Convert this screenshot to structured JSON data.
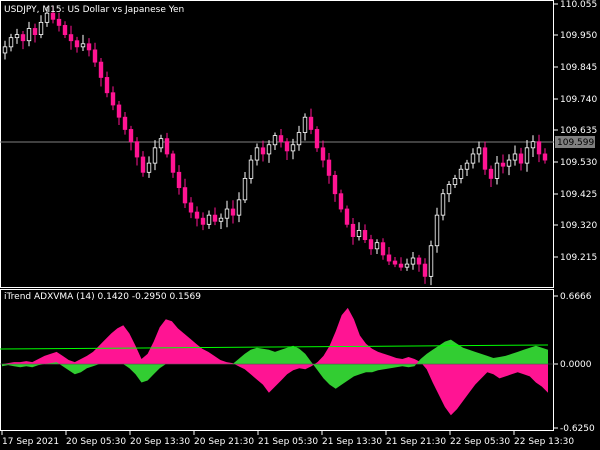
{
  "window": {
    "symbol_label": "USDJPY, M15:  US Dollar vs Japanese Yen"
  },
  "price_axis": {
    "ticks": [
      "110.055",
      "109.950",
      "109.845",
      "109.740",
      "109.635",
      "109.530",
      "109.425",
      "109.320",
      "109.215"
    ],
    "current_price": "109.599"
  },
  "indicator": {
    "label": "iTrend ADXVMA (14) 0.1420 -0.2950 0.1569",
    "ticks": [
      "0.6666",
      "0.0000",
      "-0.6250"
    ]
  },
  "time_axis": {
    "ticks": [
      "17 Sep 2021",
      "20 Sep 05:30",
      "20 Sep 13:30",
      "20 Sep 21:30",
      "21 Sep 05:30",
      "21 Sep 13:30",
      "21 Sep 21:30",
      "22 Sep 05:30",
      "22 Sep 13:30"
    ]
  },
  "colors": {
    "background": "#000000",
    "grid": "#ffffff",
    "bull_candle": "#ffffff",
    "bear_candle": "#ff1493",
    "price_line": "#808080",
    "indicator_pink": "#ff1493",
    "indicator_green": "#32cd32",
    "signal_line": "#00ff00"
  },
  "chart_data": [
    {
      "type": "candlestick",
      "title": "USDJPY, M15:  US Dollar vs Japanese Yen",
      "ylim": [
        109.155,
        110.07
      ],
      "series": [
        {
          "values": [
            109.93,
            109.96,
            109.97,
            109.95,
            109.99,
            109.97,
            110.01,
            110.04,
            110.02,
            110.0,
            109.97,
            109.95,
            109.93,
            109.94,
            109.92,
            109.88,
            109.83,
            109.78,
            109.74,
            109.7,
            109.66,
            109.62,
            109.57,
            109.52,
            109.55,
            109.6,
            109.63,
            109.58,
            109.52,
            109.47,
            109.42,
            109.39,
            109.37,
            109.35,
            109.38,
            109.36,
            109.37,
            109.4,
            109.38,
            109.43,
            109.5,
            109.56,
            109.6,
            109.58,
            109.61,
            109.64,
            109.62,
            109.59,
            109.61,
            109.65,
            109.7,
            109.66,
            109.6,
            109.56,
            109.51,
            109.45,
            109.4,
            109.35,
            109.31,
            109.33,
            109.3,
            109.27,
            109.29,
            109.25,
            109.23,
            109.22,
            109.21,
            109.22,
            109.24,
            109.22,
            109.18,
            109.28,
            109.38,
            109.45,
            109.48,
            109.5,
            109.53,
            109.55,
            109.58,
            109.6,
            109.53,
            109.5,
            109.55,
            109.54,
            109.56,
            109.58,
            109.55,
            109.6,
            109.62,
            109.58,
            109.56
          ]
        }
      ]
    },
    {
      "type": "area",
      "title": "iTrend ADXVMA (14) 0.1420 -0.2950 0.1569",
      "ylim": [
        -0.625,
        0.6666
      ],
      "series": [
        {
          "values": [
            0.0,
            0.01,
            0.02,
            0.02,
            0.03,
            0.02,
            0.05,
            0.08,
            0.1,
            0.12,
            0.08,
            0.04,
            0.02,
            0.05,
            0.08,
            0.12,
            0.18,
            0.24,
            0.3,
            0.35,
            0.38,
            0.3,
            0.18,
            0.05,
            0.1,
            0.22,
            0.36,
            0.44,
            0.42,
            0.35,
            0.3,
            0.25,
            0.2,
            0.15,
            0.12,
            0.08,
            0.04,
            0.02,
            0.01,
            -0.02,
            -0.05,
            -0.1,
            -0.15,
            -0.2,
            -0.28,
            -0.22,
            -0.16,
            -0.1,
            -0.06,
            -0.04,
            -0.05,
            -0.02,
            0.02,
            0.08,
            0.18,
            0.32,
            0.48,
            0.55,
            0.44,
            0.28,
            0.2,
            0.15,
            0.12,
            0.1,
            0.08,
            0.06,
            0.05,
            0.07,
            0.05,
            0.02,
            -0.05,
            -0.18,
            -0.3,
            -0.42,
            -0.5,
            -0.44,
            -0.36,
            -0.28,
            -0.2,
            -0.14,
            -0.08,
            -0.1,
            -0.14,
            -0.12,
            -0.1,
            -0.08,
            -0.1,
            -0.12,
            -0.18,
            -0.22,
            -0.28
          ]
        },
        {
          "values": [
            -0.02,
            -0.01,
            -0.02,
            -0.03,
            -0.02,
            -0.03,
            -0.01,
            0.0,
            0.01,
            0.02,
            -0.02,
            -0.06,
            -0.1,
            -0.08,
            -0.04,
            -0.02,
            0.0,
            0.0,
            0.0,
            0.0,
            0.0,
            -0.04,
            -0.1,
            -0.18,
            -0.16,
            -0.1,
            -0.04,
            0.0,
            0.0,
            0.0,
            0.0,
            0.0,
            0.0,
            0.0,
            0.0,
            0.0,
            0.0,
            0.0,
            0.0,
            0.05,
            0.1,
            0.14,
            0.16,
            0.15,
            0.14,
            0.12,
            0.14,
            0.16,
            0.18,
            0.15,
            0.1,
            0.02,
            -0.06,
            -0.14,
            -0.2,
            -0.24,
            -0.2,
            -0.16,
            -0.12,
            -0.1,
            -0.08,
            -0.08,
            -0.06,
            -0.05,
            -0.04,
            -0.03,
            -0.02,
            -0.03,
            -0.02,
            0.05,
            0.1,
            0.14,
            0.18,
            0.22,
            0.24,
            0.2,
            0.16,
            0.14,
            0.12,
            0.1,
            0.08,
            0.06,
            0.07,
            0.08,
            0.1,
            0.12,
            0.14,
            0.16,
            0.18,
            0.16,
            0.14
          ]
        }
      ]
    }
  ]
}
